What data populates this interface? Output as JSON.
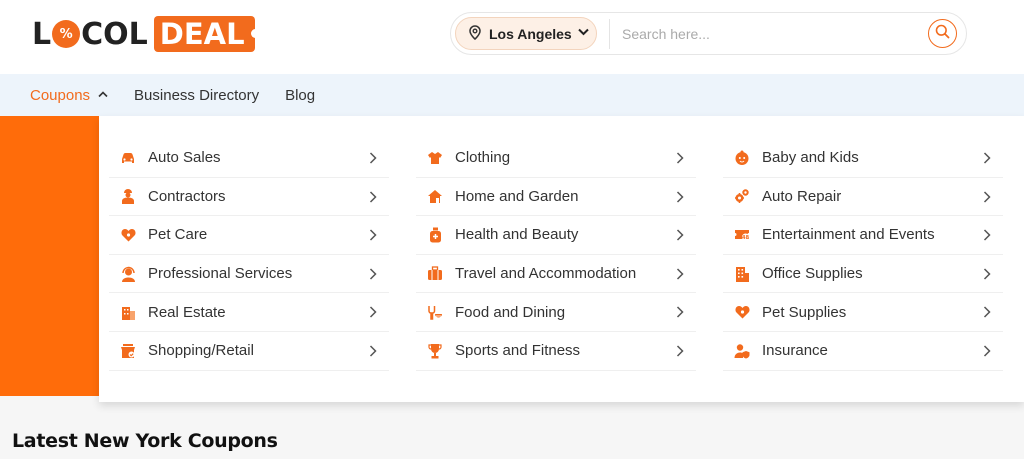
{
  "logo": {
    "part1": "L",
    "badge": "%",
    "part2": "COL",
    "part3": "DEAL"
  },
  "search": {
    "location": "Los Angeles",
    "placeholder": "Search here..."
  },
  "nav": {
    "items": [
      "Coupons",
      "Business Directory",
      "Blog"
    ]
  },
  "dropdown": {
    "columns": [
      [
        {
          "label": "Auto Sales",
          "icon": "car-icon"
        },
        {
          "label": "Contractors",
          "icon": "worker-icon"
        },
        {
          "label": "Pet Care",
          "icon": "pet-heart-icon"
        },
        {
          "label": "Professional Services",
          "icon": "support-agent-icon"
        },
        {
          "label": "Real Estate",
          "icon": "building-icon"
        },
        {
          "label": "Shopping/Retail",
          "icon": "shop-icon"
        }
      ],
      [
        {
          "label": "Clothing",
          "icon": "clothing-icon"
        },
        {
          "label": "Home and Garden",
          "icon": "home-icon"
        },
        {
          "label": "Health and Beauty",
          "icon": "beauty-bottle-icon"
        },
        {
          "label": "Travel and Accommodation",
          "icon": "luggage-icon"
        },
        {
          "label": "Food and Dining",
          "icon": "dining-icon"
        },
        {
          "label": "Sports and Fitness",
          "icon": "trophy-icon"
        }
      ],
      [
        {
          "label": "Baby and Kids",
          "icon": "baby-icon"
        },
        {
          "label": "Auto Repair",
          "icon": "gears-icon"
        },
        {
          "label": "Entertainment and Events",
          "icon": "ticket-icon"
        },
        {
          "label": "Office Supplies",
          "icon": "office-building-icon"
        },
        {
          "label": "Pet Supplies",
          "icon": "pet-heart-icon"
        },
        {
          "label": "Insurance",
          "icon": "insurance-user-icon"
        }
      ]
    ]
  },
  "section": {
    "title": "Latest New York Coupons"
  },
  "colors": {
    "accent": "#f26b1d",
    "nav_bg": "#edf4fb",
    "orange_block": "#ff6c0a"
  }
}
